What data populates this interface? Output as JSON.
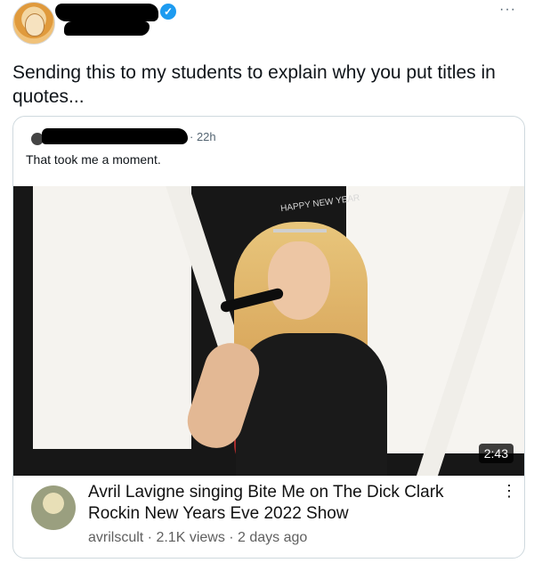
{
  "tweet": {
    "more_label": "···",
    "text": "Sending this to my students to explain why you put titles in quotes..."
  },
  "quote": {
    "time": "· 22h",
    "text": "That took me a moment."
  },
  "video": {
    "duration": "2:43",
    "crown_text": "HAPPY NEW YEAR"
  },
  "youtube": {
    "title": "Avril Lavigne singing Bite Me on The Dick Clark Rockin New Years Eve 2022 Show",
    "meta": "avrilscult · 2.1K views · 2 days ago",
    "menu_label": "⋮"
  },
  "colors": {
    "verified": "#1d9bf0"
  }
}
